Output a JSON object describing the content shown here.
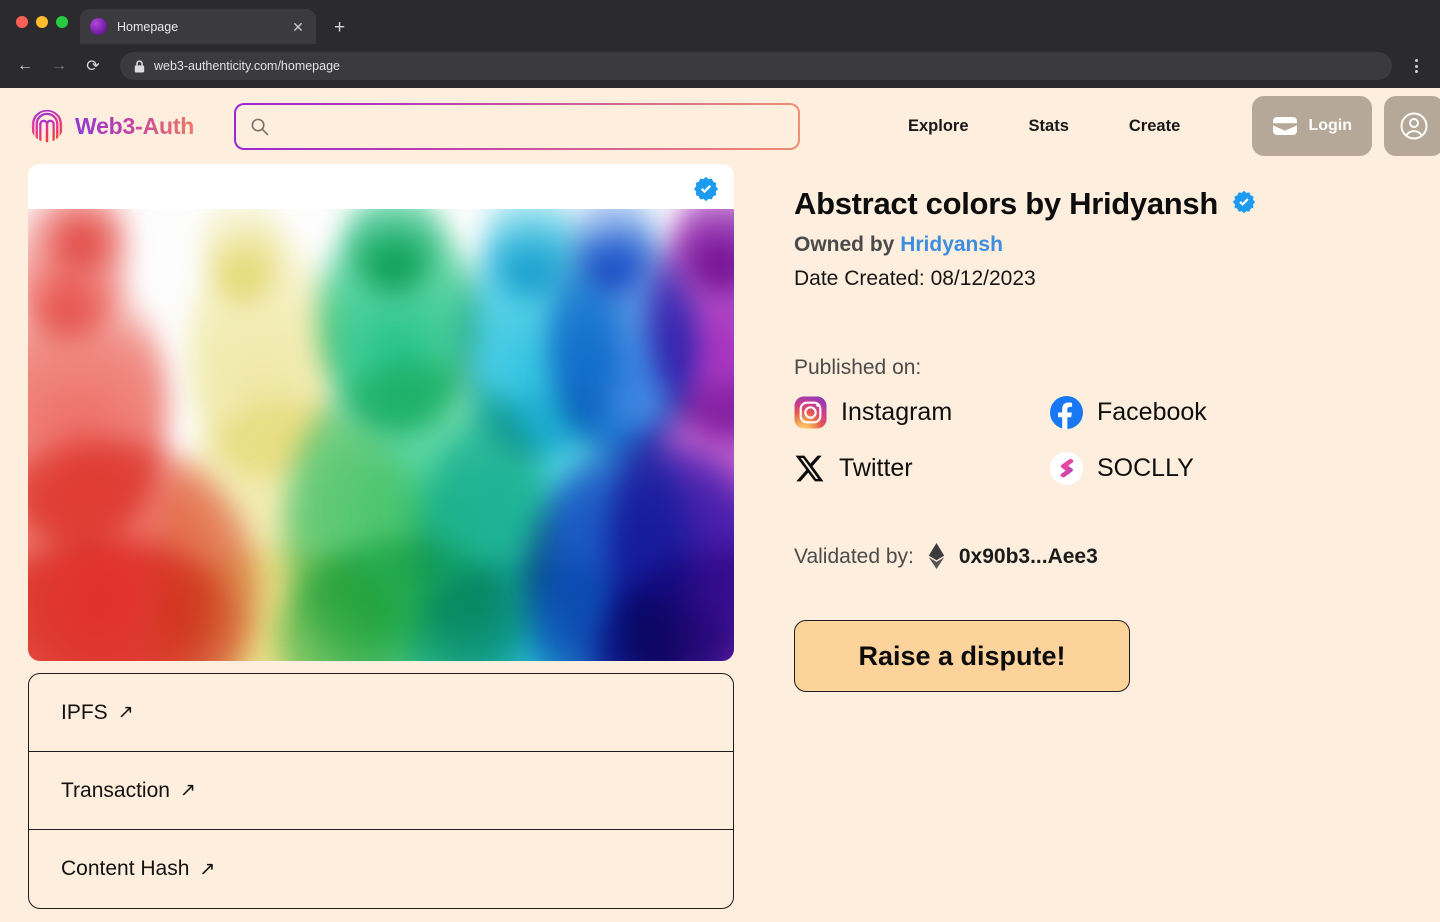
{
  "browser": {
    "tab_title": "Homepage",
    "tab_close_label": "✕",
    "new_tab_label": "+",
    "back_label": "←",
    "forward_label": "→",
    "reload_label": "⟳",
    "url": "web3-authenticity.com/homepage",
    "lock_icon": "lock-icon",
    "menu_icon": "kebab-menu-icon"
  },
  "header": {
    "logo_icon": "fingerprint-icon",
    "logo_text": "Web3-Auth",
    "search": {
      "value": "",
      "placeholder": "",
      "icon": "search-icon"
    },
    "nav": [
      {
        "label": "Explore"
      },
      {
        "label": "Stats"
      },
      {
        "label": "Create"
      }
    ],
    "login": {
      "label": "Login",
      "icon": "wallet-icon"
    },
    "account": {
      "icon": "user-circle-icon"
    }
  },
  "artwork": {
    "verified_icon": "verified-badge-icon",
    "alt": "Abstract rainbow ink in water"
  },
  "links": [
    {
      "label": "IPFS",
      "arrow": "↗"
    },
    {
      "label": "Transaction",
      "arrow": "↗"
    },
    {
      "label": "Content Hash",
      "arrow": "↗"
    }
  ],
  "detail": {
    "title": "Abstract colors by Hridyansh",
    "verified_icon": "verified-badge-icon",
    "owned_by_prefix": "Owned by",
    "owner": "Hridyansh",
    "date_created": "Date Created: 08/12/2023",
    "published_label": "Published on:",
    "platforms": [
      {
        "name": "Instagram",
        "icon": "instagram-icon"
      },
      {
        "name": "Facebook",
        "icon": "facebook-icon"
      },
      {
        "name": "Twitter",
        "icon": "twitter-x-icon"
      },
      {
        "name": "SOCLLY",
        "icon": "soclly-icon"
      }
    ],
    "validated_label": "Validated by:",
    "validator_icon": "ethereum-icon",
    "validator_address": "0x90b3...Aee3",
    "dispute_button": "Raise a dispute!"
  },
  "colors": {
    "page_background": "#fdeedd",
    "accent_purple": "#9b26d6",
    "accent_salmon": "#ef8f72",
    "link_blue": "#3d8ee0",
    "verified_blue": "#1d9bf0",
    "button_tan": "#b5a898",
    "dispute_orange": "#fbd39b",
    "chrome_dark": "#2b2b2e"
  }
}
